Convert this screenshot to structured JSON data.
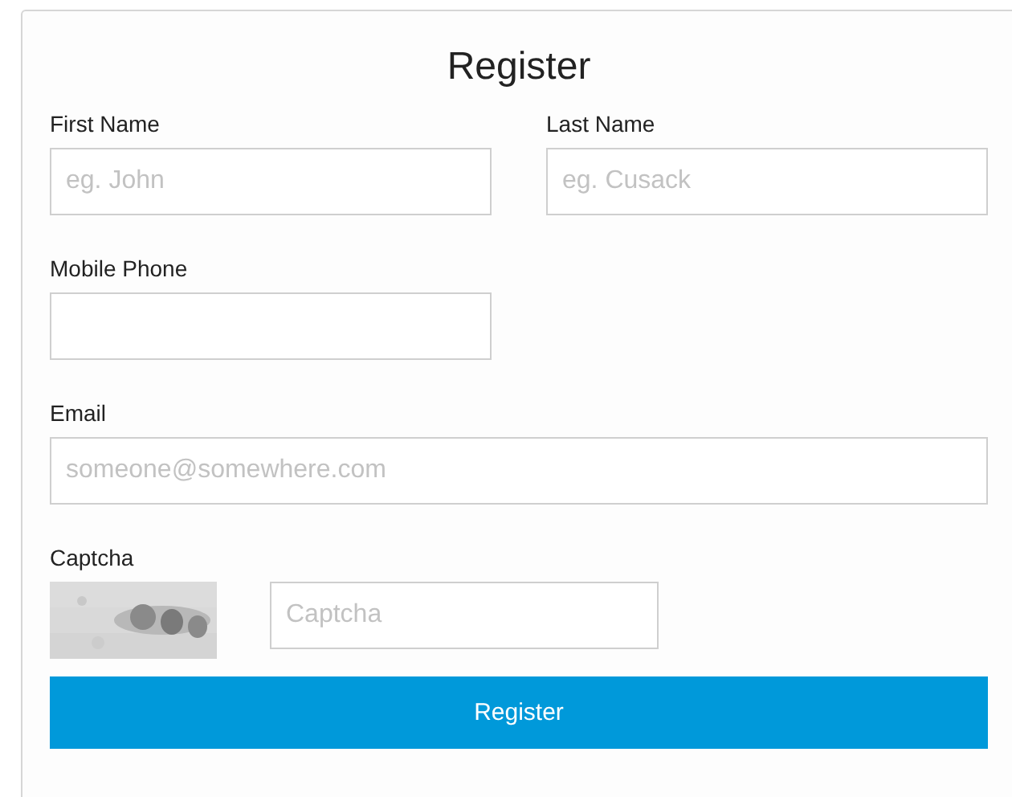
{
  "title": "Register",
  "name_fields": [
    {
      "label": "First Name",
      "placeholder": "eg. John"
    },
    {
      "label": "Last Name",
      "placeholder": "eg. Cusack"
    }
  ],
  "mobile_phone": {
    "label": "Mobile Phone"
  },
  "email": {
    "label": "Email",
    "placeholder": "someone@somewhere.com"
  },
  "captcha": {
    "label": "Captcha",
    "placeholder": "Captcha"
  },
  "submit_button": "Register"
}
